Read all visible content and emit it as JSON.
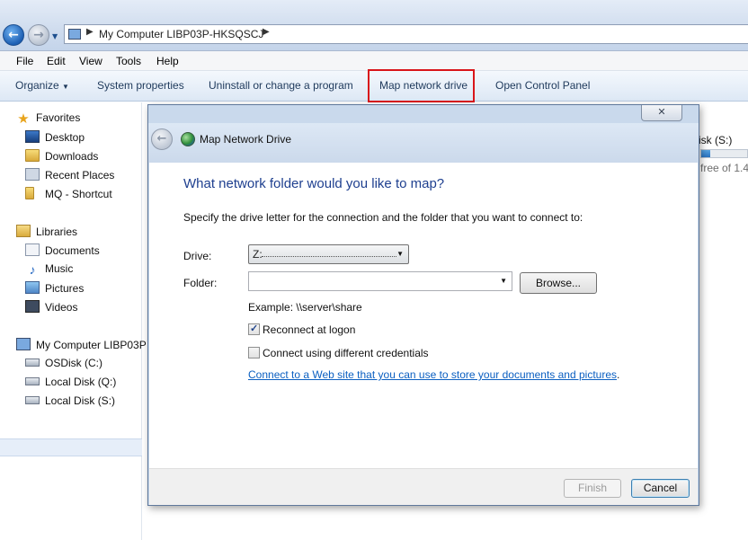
{
  "address_bar": {
    "path": "My Computer LIBP03P-HKSQSCJ"
  },
  "menu": [
    "File",
    "Edit",
    "View",
    "Tools",
    "Help"
  ],
  "command_bar": {
    "organize": "Organize",
    "system_properties": "System properties",
    "uninstall": "Uninstall or change a program",
    "map_network_drive": "Map network drive",
    "open_control_panel": "Open Control Panel"
  },
  "nav_pane": {
    "favorites": {
      "header": "Favorites",
      "items": [
        "Desktop",
        "Downloads",
        "Recent Places",
        "MQ - Shortcut"
      ]
    },
    "libraries": {
      "header": "Libraries",
      "items": [
        "Documents",
        "Music",
        "Pictures",
        "Videos"
      ]
    },
    "computer": {
      "header": "My Computer LIBP03P",
      "items": [
        "OSDisk (C:)",
        "Local Disk (Q:)",
        "Local Disk (S:)"
      ]
    }
  },
  "background_content": {
    "disk_label": "isk (S:)",
    "disk_free": "free of 1.4",
    "disk_fill_fraction": 0.19
  },
  "dialog": {
    "title": "Map Network Drive",
    "close_glyph": "✕",
    "heading": "What network folder would you like to map?",
    "instruction": "Specify the drive letter for the connection and the folder that you want to connect to:",
    "drive_label": "Drive:",
    "drive_value": "Z:",
    "folder_label": "Folder:",
    "folder_value": "",
    "browse_button": "Browse...",
    "example": "Example: \\\\server\\share",
    "reconnect_label": "Reconnect at logon",
    "reconnect_checked": true,
    "credentials_label": "Connect using different credentials",
    "credentials_checked": false,
    "link_text": "Connect to a Web site that you can use to store your documents and pictures",
    "link_suffix": ".",
    "finish_button": "Finish",
    "cancel_button": "Cancel"
  },
  "colors": {
    "highlight_box": "#d9151a",
    "heading": "#1e3f8f",
    "link": "#0b5fc1"
  }
}
